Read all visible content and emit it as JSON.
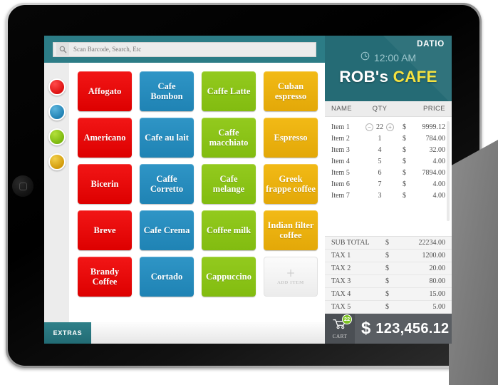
{
  "search": {
    "placeholder": "Scan Barcode, Search, Etc",
    "value": "",
    "icon": "search-icon"
  },
  "color_rail": [
    {
      "name": "red",
      "hex": "#dd1111"
    },
    {
      "name": "blue",
      "hex": "#2a8fc0"
    },
    {
      "name": "green",
      "hex": "#8cc61a"
    },
    {
      "name": "yellow",
      "hex": "#e0a814"
    }
  ],
  "tiles": [
    {
      "label": "Affogato",
      "color": "red"
    },
    {
      "label": "Cafe Bombon",
      "color": "blue"
    },
    {
      "label": "Caffe Latte",
      "color": "green"
    },
    {
      "label": "Cuban espresso",
      "color": "yellow"
    },
    {
      "label": "Americano",
      "color": "red"
    },
    {
      "label": "Cafe au lait",
      "color": "blue"
    },
    {
      "label": "Caffe macchiato",
      "color": "green"
    },
    {
      "label": "Espresso",
      "color": "yellow"
    },
    {
      "label": "Bicerin",
      "color": "red"
    },
    {
      "label": "Caffe Corretto",
      "color": "blue"
    },
    {
      "label": "Cafe melange",
      "color": "green"
    },
    {
      "label": "Greek frappe coffee",
      "color": "yellow"
    },
    {
      "label": "Breve",
      "color": "red"
    },
    {
      "label": "Cafe Crema",
      "color": "blue"
    },
    {
      "label": "Coffee milk",
      "color": "green"
    },
    {
      "label": "Indian filter coffee",
      "color": "yellow"
    },
    {
      "label": "Brandy Coffee",
      "color": "red"
    },
    {
      "label": "Cortado",
      "color": "blue"
    },
    {
      "label": "Cappuccino",
      "color": "green"
    }
  ],
  "add_tile": {
    "plus": "+",
    "label": "ADD ITEM"
  },
  "footer": {
    "extras_label": "EXTRAS"
  },
  "receipt": {
    "brand": "DATIO",
    "clock_icon": "clock-icon",
    "time": "12:00 AM",
    "shop_name_main": "ROB's ",
    "shop_name_accent": "CAFE",
    "columns": {
      "name": "NAME",
      "qty": "QTY",
      "price": "PRICE"
    },
    "currency": "$",
    "stepper": {
      "minus": "−",
      "plus": "+"
    },
    "items": [
      {
        "name": "Item 1",
        "qty": "22",
        "price": "9999.12",
        "stepper": true
      },
      {
        "name": "Item 2",
        "qty": "1",
        "price": "784.00",
        "stepper": false
      },
      {
        "name": "Item 3",
        "qty": "4",
        "price": "32.00",
        "stepper": false
      },
      {
        "name": "Item 4",
        "qty": "5",
        "price": "4.00",
        "stepper": false
      },
      {
        "name": "Item 5",
        "qty": "6",
        "price": "7894.00",
        "stepper": false
      },
      {
        "name": "Item 6",
        "qty": "7",
        "price": "4.00",
        "stepper": false
      },
      {
        "name": "Item 7",
        "qty": "3",
        "price": "4.00",
        "stepper": false
      }
    ],
    "totals": [
      {
        "label": "SUB TOTAL",
        "value": "22234.00"
      },
      {
        "label": "TAX 1",
        "value": "1200.00"
      },
      {
        "label": "TAX 2",
        "value": "20.00"
      },
      {
        "label": "TAX 3",
        "value": "80.00"
      },
      {
        "label": "TAX 4",
        "value": "15.00"
      },
      {
        "label": "TAX 5",
        "value": "5.00"
      }
    ],
    "grand_total": {
      "cart_icon": "cart-icon",
      "cart_label": "CART",
      "cart_badge": "22",
      "currency": "$",
      "amount": "123,456.12"
    }
  },
  "theme": {
    "teal_header": "#256b75",
    "teal_search": "#2c7c86",
    "accent_yellow": "#f5e23f",
    "grand_bar": "#5a5e63",
    "badge_green": "#7dc323"
  }
}
